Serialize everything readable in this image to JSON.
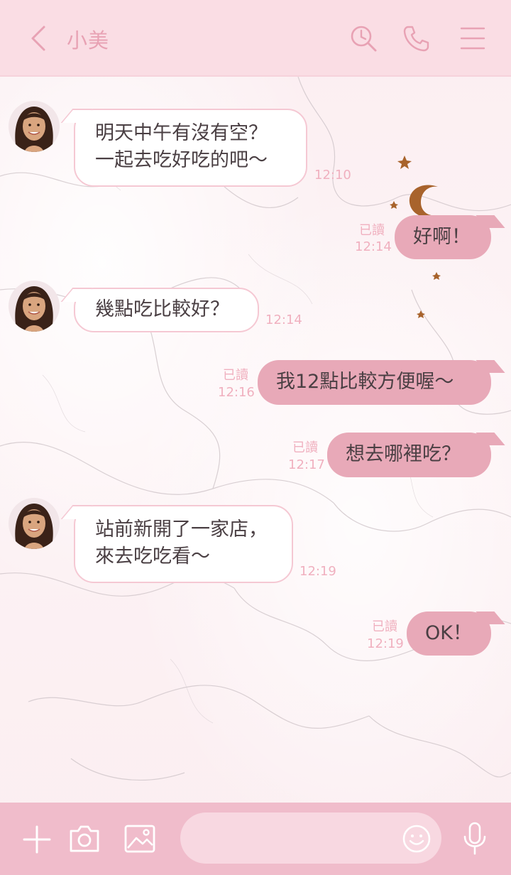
{
  "header": {
    "title": "小美",
    "back_icon": "chevron-left-icon",
    "search_icon": "search-icon",
    "call_icon": "phone-icon",
    "menu_icon": "hamburger-menu-icon"
  },
  "messages": [
    {
      "side": "in",
      "text": "明天中午有沒有空？\n一起去吃好吃的吧～",
      "time": "12:10"
    },
    {
      "side": "out",
      "text": "好啊！",
      "read": "已讀",
      "time": "12:14"
    },
    {
      "side": "in",
      "text": "幾點吃比較好？",
      "time": "12:14"
    },
    {
      "side": "out",
      "text": "我12點比較方便喔～",
      "read": "已讀",
      "time": "12:16"
    },
    {
      "side": "out",
      "text": "想去哪裡吃？",
      "read": "已讀",
      "time": "12:17"
    },
    {
      "side": "in",
      "text": "站前新開了一家店，\n來去吃吃看～",
      "time": "12:19"
    },
    {
      "side": "out",
      "text": "OK！",
      "read": "已讀",
      "time": "12:19"
    }
  ],
  "footer": {
    "add_icon": "plus-icon",
    "camera_icon": "camera-icon",
    "image_icon": "image-icon",
    "input_value": "",
    "emoji_icon": "smiley-icon",
    "mic_icon": "microphone-icon"
  },
  "colors": {
    "header_bg": "#fadde4",
    "accent": "#e8a2b4",
    "outgoing_bubble": "#e8a9b8",
    "footer_bg": "#f0bccb"
  }
}
